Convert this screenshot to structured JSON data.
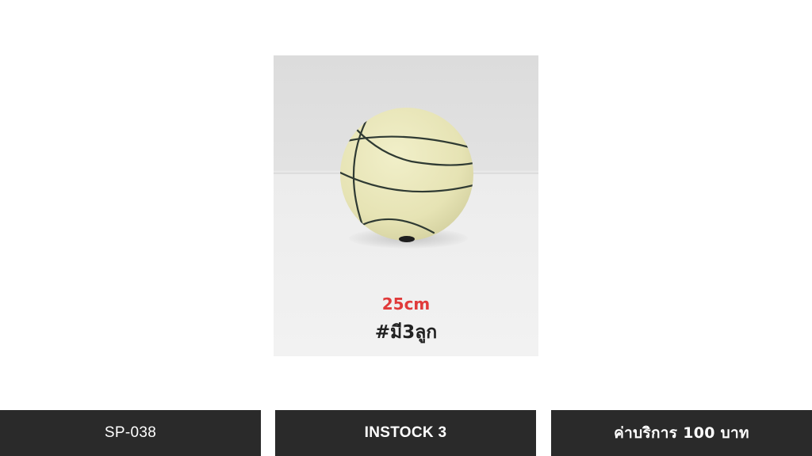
{
  "product": {
    "size_text": "25cm",
    "quantity_text": "#มี3ลูก"
  },
  "info_bar": {
    "code": "SP-038",
    "stock": "INSTOCK 3",
    "service_fee": "ค่าบริการ 100 บาท"
  },
  "colors": {
    "bar_background": "#2a2a2a",
    "size_text": "#e03a3a",
    "ball": "#e8e6b8"
  }
}
